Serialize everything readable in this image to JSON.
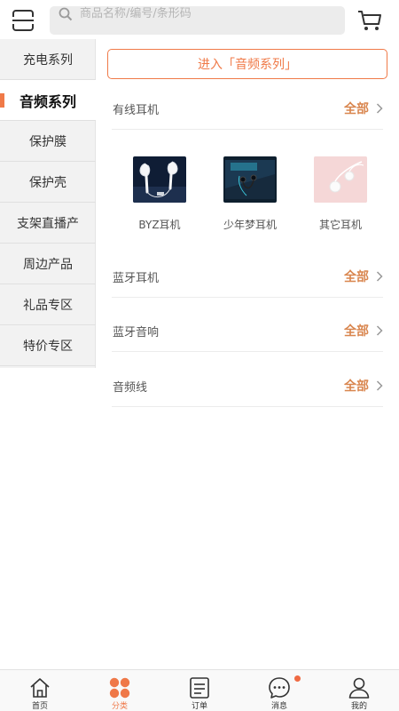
{
  "search": {
    "placeholder": "商品名称/编号/条形码"
  },
  "sidebar": {
    "items": [
      {
        "label": "充电系列"
      },
      {
        "label": "音频系列"
      },
      {
        "label": "保护膜"
      },
      {
        "label": "保护壳"
      },
      {
        "label": "支架直播产"
      },
      {
        "label": "周边产品"
      },
      {
        "label": "礼品专区"
      },
      {
        "label": "特价专区"
      }
    ],
    "active_index": 1
  },
  "content": {
    "enter_button": "进入「音频系列」",
    "sections": [
      {
        "title": "有线耳机",
        "all_label": "全部"
      },
      {
        "title": "蓝牙耳机",
        "all_label": "全部"
      },
      {
        "title": "蓝牙音响",
        "all_label": "全部"
      },
      {
        "title": "音频线",
        "all_label": "全部"
      }
    ],
    "products": [
      {
        "name": "BYZ耳机",
        "icon": "white-earphones-image"
      },
      {
        "name": "少年梦耳机",
        "icon": "black-earphones-box-image"
      },
      {
        "name": "其它耳机",
        "icon": "pink-earphones-image"
      }
    ]
  },
  "tabbar": {
    "items": [
      {
        "label": "首页",
        "icon": "home-icon"
      },
      {
        "label": "分类",
        "icon": "category-icon"
      },
      {
        "label": "订单",
        "icon": "order-icon"
      },
      {
        "label": "消息",
        "icon": "message-icon"
      },
      {
        "label": "我的",
        "icon": "profile-icon"
      }
    ],
    "active_index": 1
  },
  "colors": {
    "accent": "#f07a48",
    "all_link": "#d9864f",
    "sidebar_bg": "#f2f2f2",
    "search_bg": "#ececec"
  }
}
